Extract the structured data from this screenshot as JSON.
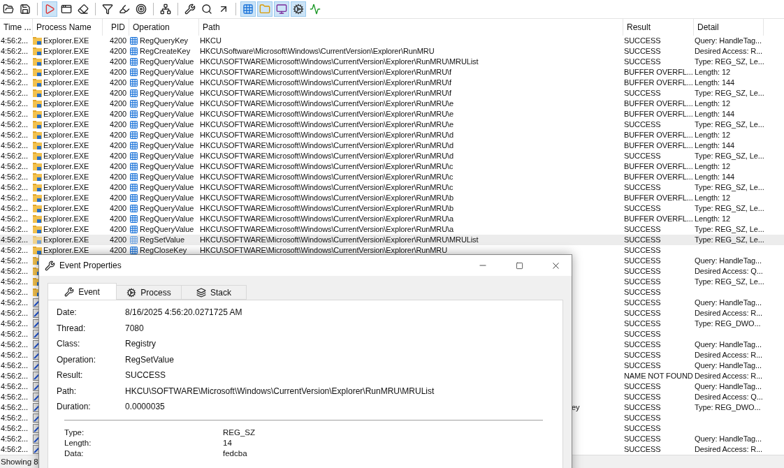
{
  "toolbar": [
    [
      {
        "kind": "open",
        "selected": false
      },
      {
        "kind": "save",
        "selected": false
      }
    ],
    [
      {
        "kind": "capture",
        "selected": true
      },
      {
        "kind": "autoscroll",
        "selected": false
      },
      {
        "kind": "clear",
        "selected": false
      }
    ],
    [
      {
        "kind": "filter",
        "selected": false
      },
      {
        "kind": "highlight",
        "selected": false
      },
      {
        "kind": "target",
        "selected": false
      }
    ],
    [
      {
        "kind": "tree",
        "selected": false
      }
    ],
    [
      {
        "kind": "properties",
        "selected": false
      },
      {
        "kind": "find",
        "selected": false
      },
      {
        "kind": "jump",
        "selected": false
      }
    ],
    [
      {
        "kind": "registry",
        "selected": true
      },
      {
        "kind": "filesystem",
        "selected": true
      },
      {
        "kind": "network",
        "selected": true
      },
      {
        "kind": "process",
        "selected": true
      },
      {
        "kind": "profiling",
        "selected": false
      }
    ]
  ],
  "table": {
    "columns": [
      "Time ...",
      "Process Name",
      "PID",
      "Operation",
      "Path",
      "Result",
      "Detail"
    ],
    "rows": [
      {
        "time": "4:56:2...",
        "kind": "explorer",
        "process": "Explorer.EXE",
        "pid": "4200",
        "operation": "RegQueryKey",
        "path": "HKCU",
        "result": "SUCCESS",
        "detail": "Query: HandleTag...",
        "selected": false
      },
      {
        "time": "4:56:2...",
        "kind": "explorer",
        "process": "Explorer.EXE",
        "pid": "4200",
        "operation": "RegCreateKey",
        "path": "HKCU\\Software\\Microsoft\\Windows\\CurrentVersion\\Explorer\\RunMRU",
        "result": "SUCCESS",
        "detail": "Desired Access: R...",
        "selected": false
      },
      {
        "time": "4:56:2...",
        "kind": "explorer",
        "process": "Explorer.EXE",
        "pid": "4200",
        "operation": "RegQueryValue",
        "path": "HKCU\\SOFTWARE\\Microsoft\\Windows\\CurrentVersion\\Explorer\\RunMRU\\MRUList",
        "result": "SUCCESS",
        "detail": "Type: REG_SZ, Le...",
        "selected": false
      },
      {
        "time": "4:56:2...",
        "kind": "explorer",
        "process": "Explorer.EXE",
        "pid": "4200",
        "operation": "RegQueryValue",
        "path": "HKCU\\SOFTWARE\\Microsoft\\Windows\\CurrentVersion\\Explorer\\RunMRU\\f",
        "result": "BUFFER OVERFL...",
        "detail": "Length: 12",
        "selected": false
      },
      {
        "time": "4:56:2...",
        "kind": "explorer",
        "process": "Explorer.EXE",
        "pid": "4200",
        "operation": "RegQueryValue",
        "path": "HKCU\\SOFTWARE\\Microsoft\\Windows\\CurrentVersion\\Explorer\\RunMRU\\f",
        "result": "BUFFER OVERFL...",
        "detail": "Length: 144",
        "selected": false
      },
      {
        "time": "4:56:2...",
        "kind": "explorer",
        "process": "Explorer.EXE",
        "pid": "4200",
        "operation": "RegQueryValue",
        "path": "HKCU\\SOFTWARE\\Microsoft\\Windows\\CurrentVersion\\Explorer\\RunMRU\\f",
        "result": "SUCCESS",
        "detail": "Type: REG_SZ, Le...",
        "selected": false
      },
      {
        "time": "4:56:2...",
        "kind": "explorer",
        "process": "Explorer.EXE",
        "pid": "4200",
        "operation": "RegQueryValue",
        "path": "HKCU\\SOFTWARE\\Microsoft\\Windows\\CurrentVersion\\Explorer\\RunMRU\\e",
        "result": "BUFFER OVERFL...",
        "detail": "Length: 12",
        "selected": false
      },
      {
        "time": "4:56:2...",
        "kind": "explorer",
        "process": "Explorer.EXE",
        "pid": "4200",
        "operation": "RegQueryValue",
        "path": "HKCU\\SOFTWARE\\Microsoft\\Windows\\CurrentVersion\\Explorer\\RunMRU\\e",
        "result": "BUFFER OVERFL...",
        "detail": "Length: 144",
        "selected": false
      },
      {
        "time": "4:56:2...",
        "kind": "explorer",
        "process": "Explorer.EXE",
        "pid": "4200",
        "operation": "RegQueryValue",
        "path": "HKCU\\SOFTWARE\\Microsoft\\Windows\\CurrentVersion\\Explorer\\RunMRU\\e",
        "result": "SUCCESS",
        "detail": "Type: REG_SZ, Le...",
        "selected": false
      },
      {
        "time": "4:56:2...",
        "kind": "explorer",
        "process": "Explorer.EXE",
        "pid": "4200",
        "operation": "RegQueryValue",
        "path": "HKCU\\SOFTWARE\\Microsoft\\Windows\\CurrentVersion\\Explorer\\RunMRU\\d",
        "result": "BUFFER OVERFL...",
        "detail": "Length: 12",
        "selected": false
      },
      {
        "time": "4:56:2...",
        "kind": "explorer",
        "process": "Explorer.EXE",
        "pid": "4200",
        "operation": "RegQueryValue",
        "path": "HKCU\\SOFTWARE\\Microsoft\\Windows\\CurrentVersion\\Explorer\\RunMRU\\d",
        "result": "BUFFER OVERFL...",
        "detail": "Length: 144",
        "selected": false
      },
      {
        "time": "4:56:2...",
        "kind": "explorer",
        "process": "Explorer.EXE",
        "pid": "4200",
        "operation": "RegQueryValue",
        "path": "HKCU\\SOFTWARE\\Microsoft\\Windows\\CurrentVersion\\Explorer\\RunMRU\\d",
        "result": "SUCCESS",
        "detail": "Type: REG_SZ, Le...",
        "selected": false
      },
      {
        "time": "4:56:2...",
        "kind": "explorer",
        "process": "Explorer.EXE",
        "pid": "4200",
        "operation": "RegQueryValue",
        "path": "HKCU\\SOFTWARE\\Microsoft\\Windows\\CurrentVersion\\Explorer\\RunMRU\\c",
        "result": "BUFFER OVERFL...",
        "detail": "Length: 12",
        "selected": false
      },
      {
        "time": "4:56:2...",
        "kind": "explorer",
        "process": "Explorer.EXE",
        "pid": "4200",
        "operation": "RegQueryValue",
        "path": "HKCU\\SOFTWARE\\Microsoft\\Windows\\CurrentVersion\\Explorer\\RunMRU\\c",
        "result": "BUFFER OVERFL...",
        "detail": "Length: 144",
        "selected": false
      },
      {
        "time": "4:56:2...",
        "kind": "explorer",
        "process": "Explorer.EXE",
        "pid": "4200",
        "operation": "RegQueryValue",
        "path": "HKCU\\SOFTWARE\\Microsoft\\Windows\\CurrentVersion\\Explorer\\RunMRU\\c",
        "result": "SUCCESS",
        "detail": "Type: REG_SZ, Le...",
        "selected": false
      },
      {
        "time": "4:56:2...",
        "kind": "explorer",
        "process": "Explorer.EXE",
        "pid": "4200",
        "operation": "RegQueryValue",
        "path": "HKCU\\SOFTWARE\\Microsoft\\Windows\\CurrentVersion\\Explorer\\RunMRU\\b",
        "result": "BUFFER OVERFL...",
        "detail": "Length: 12",
        "selected": false
      },
      {
        "time": "4:56:2...",
        "kind": "explorer",
        "process": "Explorer.EXE",
        "pid": "4200",
        "operation": "RegQueryValue",
        "path": "HKCU\\SOFTWARE\\Microsoft\\Windows\\CurrentVersion\\Explorer\\RunMRU\\b",
        "result": "SUCCESS",
        "detail": "Type: REG_SZ, Le...",
        "selected": false
      },
      {
        "time": "4:56:2...",
        "kind": "explorer",
        "process": "Explorer.EXE",
        "pid": "4200",
        "operation": "RegQueryValue",
        "path": "HKCU\\SOFTWARE\\Microsoft\\Windows\\CurrentVersion\\Explorer\\RunMRU\\a",
        "result": "BUFFER OVERFL...",
        "detail": "Length: 12",
        "selected": false
      },
      {
        "time": "4:56:2...",
        "kind": "explorer",
        "process": "Explorer.EXE",
        "pid": "4200",
        "operation": "RegQueryValue",
        "path": "HKCU\\SOFTWARE\\Microsoft\\Windows\\CurrentVersion\\Explorer\\RunMRU\\a",
        "result": "SUCCESS",
        "detail": "Type: REG_SZ, Le...",
        "selected": false
      },
      {
        "time": "4:56:2...",
        "kind": "explorer",
        "process": "Explorer.EXE",
        "pid": "4200",
        "operation": "RegSetValue",
        "path": "HKCU\\SOFTWARE\\Microsoft\\Windows\\CurrentVersion\\Explorer\\RunMRU\\MRUList",
        "result": "SUCCESS",
        "detail": "Type: REG_SZ, Le...",
        "selected": true
      },
      {
        "time": "4:56:2...",
        "kind": "explorer",
        "process": "Explorer.EXE",
        "pid": "4200",
        "operation": "RegCloseKey",
        "path": "HKCU\\SOFTWARE\\Microsoft\\Windows\\CurrentVersion\\Explorer\\RunMRU",
        "result": "SUCCESS",
        "selected": false
      },
      {
        "time": "4:56:2...",
        "kind": "explorer",
        "covered": true,
        "result": "SUCCESS",
        "detail": "Query: HandleTag...",
        "selected": false
      },
      {
        "time": "4:56:2...",
        "kind": "explorer",
        "covered": true,
        "result": "SUCCESS",
        "detail": "Desired Access: Q...",
        "selected": false
      },
      {
        "time": "4:56:2...",
        "kind": "explorer",
        "covered": true,
        "result": "SUCCESS",
        "detail": "Type: REG_SZ, Le...",
        "selected": false
      },
      {
        "time": "4:56:2...",
        "kind": "explorer",
        "covered": true,
        "result": "SUCCESS",
        "selected": false
      },
      {
        "time": "4:56:2...",
        "kind": "other",
        "covered": true,
        "result": "SUCCESS",
        "detail": "Query: HandleTag...",
        "selected": false
      },
      {
        "time": "4:56:2...",
        "kind": "other",
        "covered": true,
        "result": "SUCCESS",
        "detail": "Desired Access: R...",
        "selected": false
      },
      {
        "time": "4:56:2...",
        "kind": "other",
        "covered": true,
        "result": "SUCCESS",
        "detail": "Type: REG_DWO...",
        "selected": false
      },
      {
        "time": "4:56:2...",
        "kind": "other",
        "covered": true,
        "result": "SUCCESS",
        "selected": false
      },
      {
        "time": "4:56:2...",
        "kind": "other",
        "covered": true,
        "result": "SUCCESS",
        "detail": "Query: HandleTag...",
        "selected": false
      },
      {
        "time": "4:56:2...",
        "kind": "other",
        "covered": true,
        "result": "SUCCESS",
        "detail": "Desired Access: R...",
        "selected": false
      },
      {
        "time": "4:56:2...",
        "kind": "other",
        "covered": true,
        "result": "SUCCESS",
        "detail": "Query: HandleTag...",
        "selected": false
      },
      {
        "time": "4:56:2...",
        "kind": "other",
        "covered": true,
        "result": "NAME NOT FOUND",
        "detail": "Desired Access: R...",
        "selected": false
      },
      {
        "time": "4:56:2...",
        "kind": "other",
        "covered": true,
        "result": "SUCCESS",
        "detail": "Query: HandleTag...",
        "selected": false
      },
      {
        "time": "4:56:2...",
        "kind": "other",
        "covered": true,
        "result": "SUCCESS",
        "detail": "Desired Access: Q...",
        "selected": false
      },
      {
        "time": "4:56:2...",
        "kind": "other",
        "covered": true,
        "path": "ey",
        "result": "SUCCESS",
        "detail": "Type: REG_DWO...",
        "selected": false
      },
      {
        "time": "4:56:2...",
        "kind": "other",
        "covered": true,
        "result": "SUCCESS",
        "selected": false
      },
      {
        "time": "4:56:2...",
        "kind": "other",
        "covered": true,
        "result": "SUCCESS",
        "selected": false
      },
      {
        "time": "4:56:2...",
        "kind": "other",
        "covered": true,
        "result": "SUCCESS",
        "detail": "Query: HandleTag...",
        "selected": false
      },
      {
        "time": "4:56:2...",
        "kind": "other",
        "covered": true,
        "result": "SUCCESS",
        "detail": "Desired Access: R...",
        "selected": false
      }
    ]
  },
  "status_bar": "Showing 8",
  "dialog": {
    "title": "Event Properties",
    "tabs": [
      {
        "label": "Event",
        "kind": "event",
        "selected": true
      },
      {
        "label": "Process",
        "kind": "process",
        "selected": false
      },
      {
        "label": "Stack",
        "kind": "stack",
        "selected": false
      }
    ],
    "fields": [
      {
        "label": "Date:",
        "value": "8/16/2025 4:56:20.0271725 AM"
      },
      {
        "label": "Thread:",
        "value": "7080"
      },
      {
        "label": "Class:",
        "value": "Registry"
      },
      {
        "label": "Operation:",
        "value": "RegSetValue"
      },
      {
        "label": "Result:",
        "value": "SUCCESS"
      },
      {
        "label": "Path:",
        "value": "HKCU\\SOFTWARE\\Microsoft\\Windows\\CurrentVersion\\Explorer\\RunMRU\\MRUList"
      },
      {
        "label": "Duration:",
        "value": "0.0000035"
      }
    ],
    "details": [
      {
        "label": "Type:",
        "value": "REG_SZ"
      },
      {
        "label": "Length:",
        "value": "14"
      },
      {
        "label": "Data:",
        "value": "fedcba"
      }
    ]
  }
}
